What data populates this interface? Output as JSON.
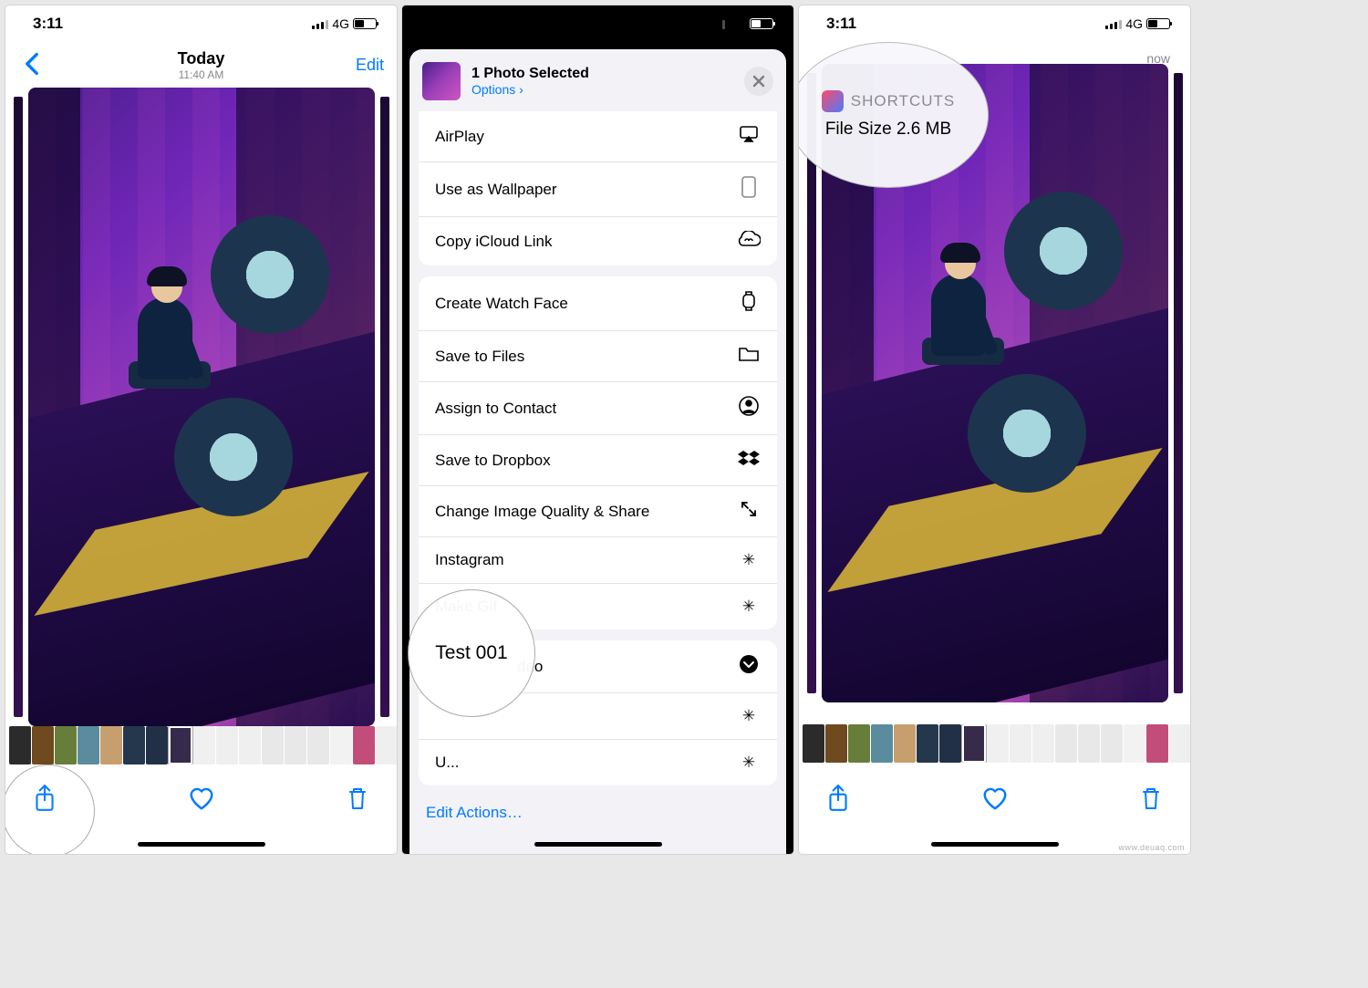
{
  "status": {
    "time": "3:11",
    "net": "4G"
  },
  "p1": {
    "title": "Today",
    "subtitle": "11:40 AM",
    "edit": "Edit"
  },
  "p2": {
    "title": "1 Photo Selected",
    "options": "Options ›",
    "group1": [
      "AirPlay",
      "Use as Wallpaper",
      "Copy iCloud Link"
    ],
    "group2": [
      "Create Watch Face",
      "Save to Files",
      "Assign to Contact",
      "Save to Dropbox",
      "Change Image Quality & Share",
      "Instagram",
      "Make Gif"
    ],
    "partial_deo": "deo",
    "editActions": "Edit Actions…",
    "highlight": "Test 001"
  },
  "p3": {
    "now": "now",
    "app": "SHORTCUTS",
    "msg": "File Size 2.6 MB"
  },
  "thumbColors": [
    "#2b2b2b",
    "#6e4a1e",
    "#667e3a",
    "#5a8c9e",
    "#c79f6e",
    "#24374c",
    "#223047",
    "#362b4a",
    "#f0f0f0",
    "#efefef",
    "#efefef",
    "#e8e8e8",
    "#e8e8e8",
    "#e8e8e8",
    "#f2f2f2",
    "#c34d7a",
    "#efefef"
  ],
  "watermark": "www.deuaq.com"
}
